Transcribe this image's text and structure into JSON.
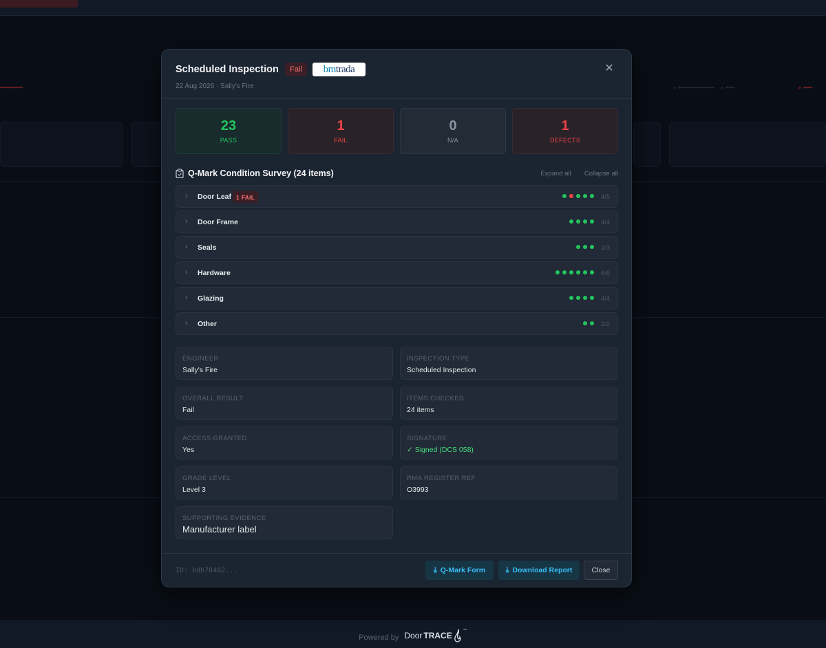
{
  "modal": {
    "title": "Scheduled Inspection",
    "status": "Fail",
    "logo_left": "bm",
    "logo_right": "trada",
    "subtitle": "22 Aug 2026 · Sally's Fire",
    "close_icon": "close-icon"
  },
  "stats": [
    {
      "value": "23",
      "label": "PASS"
    },
    {
      "value": "1",
      "label": "FAIL"
    },
    {
      "value": "0",
      "label": "N/A"
    },
    {
      "value": "1",
      "label": "DEFECTS"
    }
  ],
  "survey": {
    "title": "Q-Mark Condition Survey (24 items)",
    "expand_all": "Expand all",
    "separator": "·",
    "collapse_all": "Collapse all",
    "items": [
      {
        "name": "Door Leaf",
        "badge": "1 FAIL",
        "dots": [
          "pass",
          "fail",
          "pass",
          "pass",
          "pass"
        ],
        "count": "4/5"
      },
      {
        "name": "Door Frame",
        "badge": "",
        "dots": [
          "pass",
          "pass",
          "pass",
          "pass"
        ],
        "count": "4/4"
      },
      {
        "name": "Seals",
        "badge": "",
        "dots": [
          "pass",
          "pass",
          "pass"
        ],
        "count": "3/3"
      },
      {
        "name": "Hardware",
        "badge": "",
        "dots": [
          "pass",
          "pass",
          "pass",
          "pass",
          "pass",
          "pass"
        ],
        "count": "6/6"
      },
      {
        "name": "Glazing",
        "badge": "",
        "dots": [
          "pass",
          "pass",
          "pass",
          "pass"
        ],
        "count": "4/4"
      },
      {
        "name": "Other",
        "badge": "",
        "dots": [
          "pass",
          "pass"
        ],
        "count": "2/2"
      }
    ]
  },
  "details": {
    "engineer": {
      "label": "ENGINEER",
      "value": "Sally's Fire"
    },
    "inspection_type": {
      "label": "INSPECTION TYPE",
      "value": "Scheduled Inspection"
    },
    "overall_result": {
      "label": "OVERALL RESULT",
      "value": "Fail"
    },
    "items_checked": {
      "label": "ITEMS CHECKED",
      "value": "24 items"
    },
    "access_granted": {
      "label": "ACCESS GRANTED",
      "value": "Yes"
    },
    "signature": {
      "label": "SIGNATURE",
      "value": "✓ Signed (DCS 058)"
    },
    "grade_level": {
      "label": "GRADE LEVEL",
      "value": "Level 3"
    },
    "rma_ref": {
      "label": "RMA REGISTER REF",
      "value": "O3993"
    },
    "supporting_evidence": {
      "label": "SUPPORTING EVIDENCE",
      "value": "Manufacturer label"
    }
  },
  "footer": {
    "id": "ID: bdb78482...",
    "qmark_button": "Q-Mark Form",
    "download_button": "Download Report",
    "close_button": "Close"
  },
  "page_footer": {
    "powered_by": "Powered by",
    "brand_a": "Door",
    "brand_b": "TRACE",
    "tm": "™"
  },
  "colors": {
    "pass": "#22c55e",
    "fail": "#ef4444",
    "accent": "#38bdf8",
    "modal_bg": "#1b2431"
  }
}
